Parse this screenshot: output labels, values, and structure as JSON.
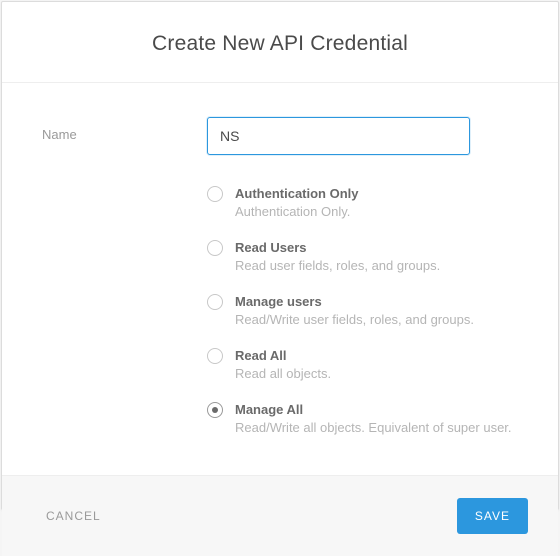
{
  "dialog": {
    "title": "Create New API Credential"
  },
  "form": {
    "name_label": "Name",
    "name_value": "NS"
  },
  "options": [
    {
      "label": "Authentication Only",
      "description": "Authentication Only.",
      "selected": false
    },
    {
      "label": "Read Users",
      "description": "Read user fields, roles, and groups.",
      "selected": false
    },
    {
      "label": "Manage users",
      "description": "Read/Write user fields, roles, and groups.",
      "selected": false
    },
    {
      "label": "Read All",
      "description": "Read all objects.",
      "selected": false
    },
    {
      "label": "Manage All",
      "description": "Read/Write all objects. Equivalent of super user.",
      "selected": true
    }
  ],
  "footer": {
    "cancel_label": "CANCEL",
    "save_label": "SAVE"
  }
}
